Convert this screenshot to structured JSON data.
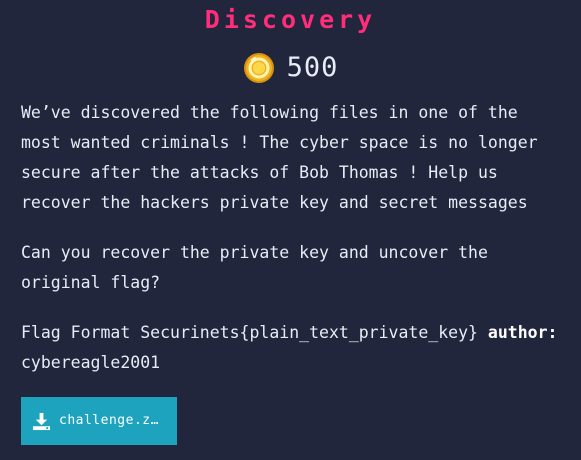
{
  "challenge": {
    "title": "Discovery",
    "points": "500",
    "description_1": "We’ve discovered the following files in one of the\nmost wanted criminals ! The cyber space is no longer\nsecure after the attacks of Bob Thomas ! Help us\nrecover the hackers private key and secret messages",
    "description_2": "Can you recover the private key and uncover the\noriginal flag?",
    "flag_format": "Flag Format Securinets{plain_text_private_key}",
    "author_label": "author:",
    "author_name": "cybereagle2001"
  },
  "download": {
    "label": "challenge.z…",
    "icon": "download-icon"
  },
  "colors": {
    "background": "#22263d",
    "title": "#ff2d7a",
    "button": "#1da3bd",
    "coin": "#f0b323"
  }
}
